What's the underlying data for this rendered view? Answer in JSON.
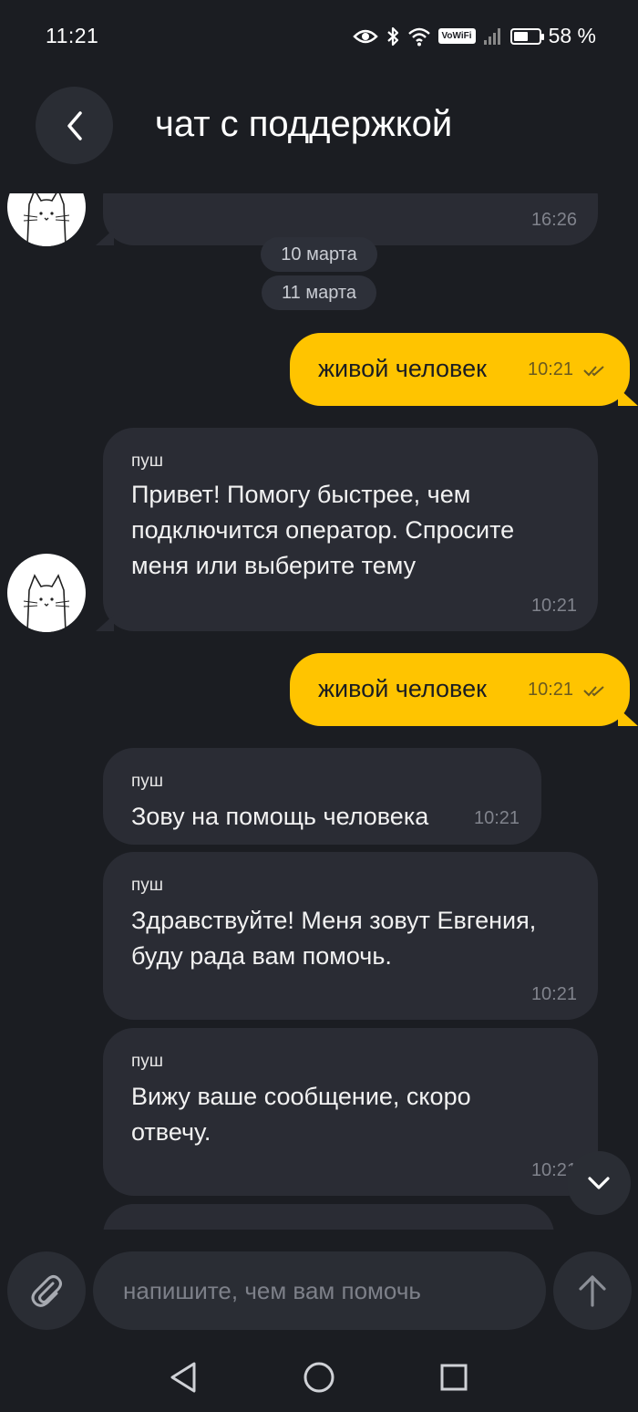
{
  "status_bar": {
    "time": "11:21",
    "vowifi": "VoWiFi",
    "battery_text": "58 %",
    "battery_level": 0.58
  },
  "header": {
    "title": "чат с поддержкой"
  },
  "messages": [
    {
      "type": "in",
      "text": "",
      "time": "16:26"
    },
    {
      "type": "date",
      "text": "10 марта"
    },
    {
      "type": "date",
      "text": "11 марта"
    },
    {
      "type": "out",
      "text": "живой человек",
      "time": "10:21",
      "read": true
    },
    {
      "type": "in",
      "sender": "пуш",
      "text": "Привет! Помогу быстрее, чем подключится оператор. Спросите меня или выберите тему",
      "time": "10:21"
    },
    {
      "type": "out",
      "text": "живой человек",
      "time": "10:21",
      "read": true
    },
    {
      "type": "in",
      "sender": "пуш",
      "text": "Зову на помощь человека",
      "time": "10:21"
    },
    {
      "type": "in",
      "sender": "пуш",
      "text": "Здравствуйте! Меня зовут Евгения, буду рада вам помочь.",
      "time": "10:21"
    },
    {
      "type": "in",
      "sender": "пуш",
      "text": "Вижу ваше сообщение, скоро отвечу.",
      "time": "10:21"
    }
  ],
  "input": {
    "placeholder": "напишите, чем вам помочь"
  },
  "colors": {
    "background": "#1b1d22",
    "bubble_in": "#2a2c34",
    "bubble_out": "#ffc400"
  },
  "icons": [
    "eye-icon",
    "bluetooth-icon",
    "wifi-icon",
    "signal-icon",
    "battery-icon",
    "back-chevron-icon",
    "cat-avatar-icon",
    "read-ticks-icon",
    "chevron-down-icon",
    "paperclip-icon",
    "send-arrow-icon",
    "nav-back-icon",
    "nav-home-icon",
    "nav-recents-icon"
  ]
}
